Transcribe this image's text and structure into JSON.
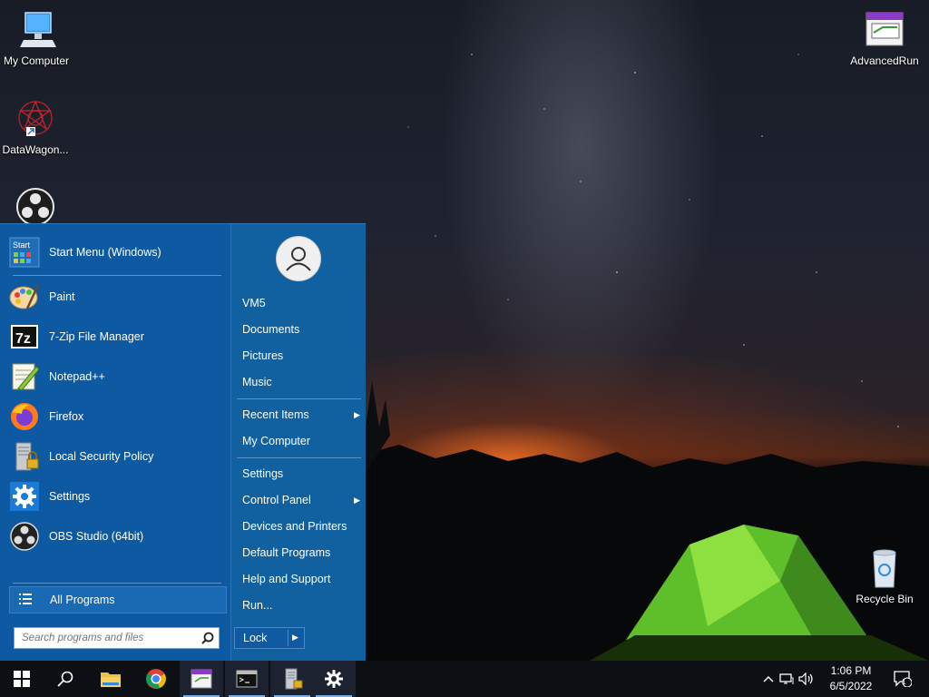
{
  "desktop": {
    "icons": [
      {
        "label": "My Computer"
      },
      {
        "label": "DataWagon..."
      },
      {
        "label": "AdvancedRun"
      },
      {
        "label": "Recycle Bin"
      }
    ]
  },
  "start_menu": {
    "pinned": [
      {
        "label": "Start Menu (Windows)",
        "icon": "start-menu-icon"
      },
      {
        "label": "Paint",
        "icon": "paint-icon"
      },
      {
        "label": "7-Zip File Manager",
        "icon": "7zip-icon"
      },
      {
        "label": "Notepad++",
        "icon": "notepadpp-icon"
      },
      {
        "label": "Firefox",
        "icon": "firefox-icon"
      },
      {
        "label": "Local Security Policy",
        "icon": "security-policy-icon"
      },
      {
        "label": "Settings",
        "icon": "gear-icon"
      },
      {
        "label": "OBS Studio (64bit)",
        "icon": "obs-icon"
      }
    ],
    "start_icon_text": "Start",
    "sevenzip_icon_text": "7z",
    "all_programs": "All Programs",
    "search_placeholder": "Search programs and files",
    "right_items": [
      {
        "label": "VM5"
      },
      {
        "label": "Documents"
      },
      {
        "label": "Pictures"
      },
      {
        "label": "Music"
      },
      {
        "label": "Recent Items",
        "arrow": "▶"
      },
      {
        "label": "My Computer"
      },
      {
        "label": "Settings"
      },
      {
        "label": "Control Panel",
        "arrow": "▶"
      },
      {
        "label": "Devices and Printers"
      },
      {
        "label": "Default Programs"
      },
      {
        "label": "Help and Support"
      },
      {
        "label": "Run..."
      }
    ],
    "lock_label": "Lock",
    "lock_arrow": "▶"
  },
  "taskbar": {
    "time": "1:06 PM",
    "date": "6/5/2022",
    "notification_count": "1"
  },
  "colors": {
    "menu_blue": "#0f5ea8",
    "taskbar": "#0c0f14",
    "accent": "#7aaee0"
  }
}
